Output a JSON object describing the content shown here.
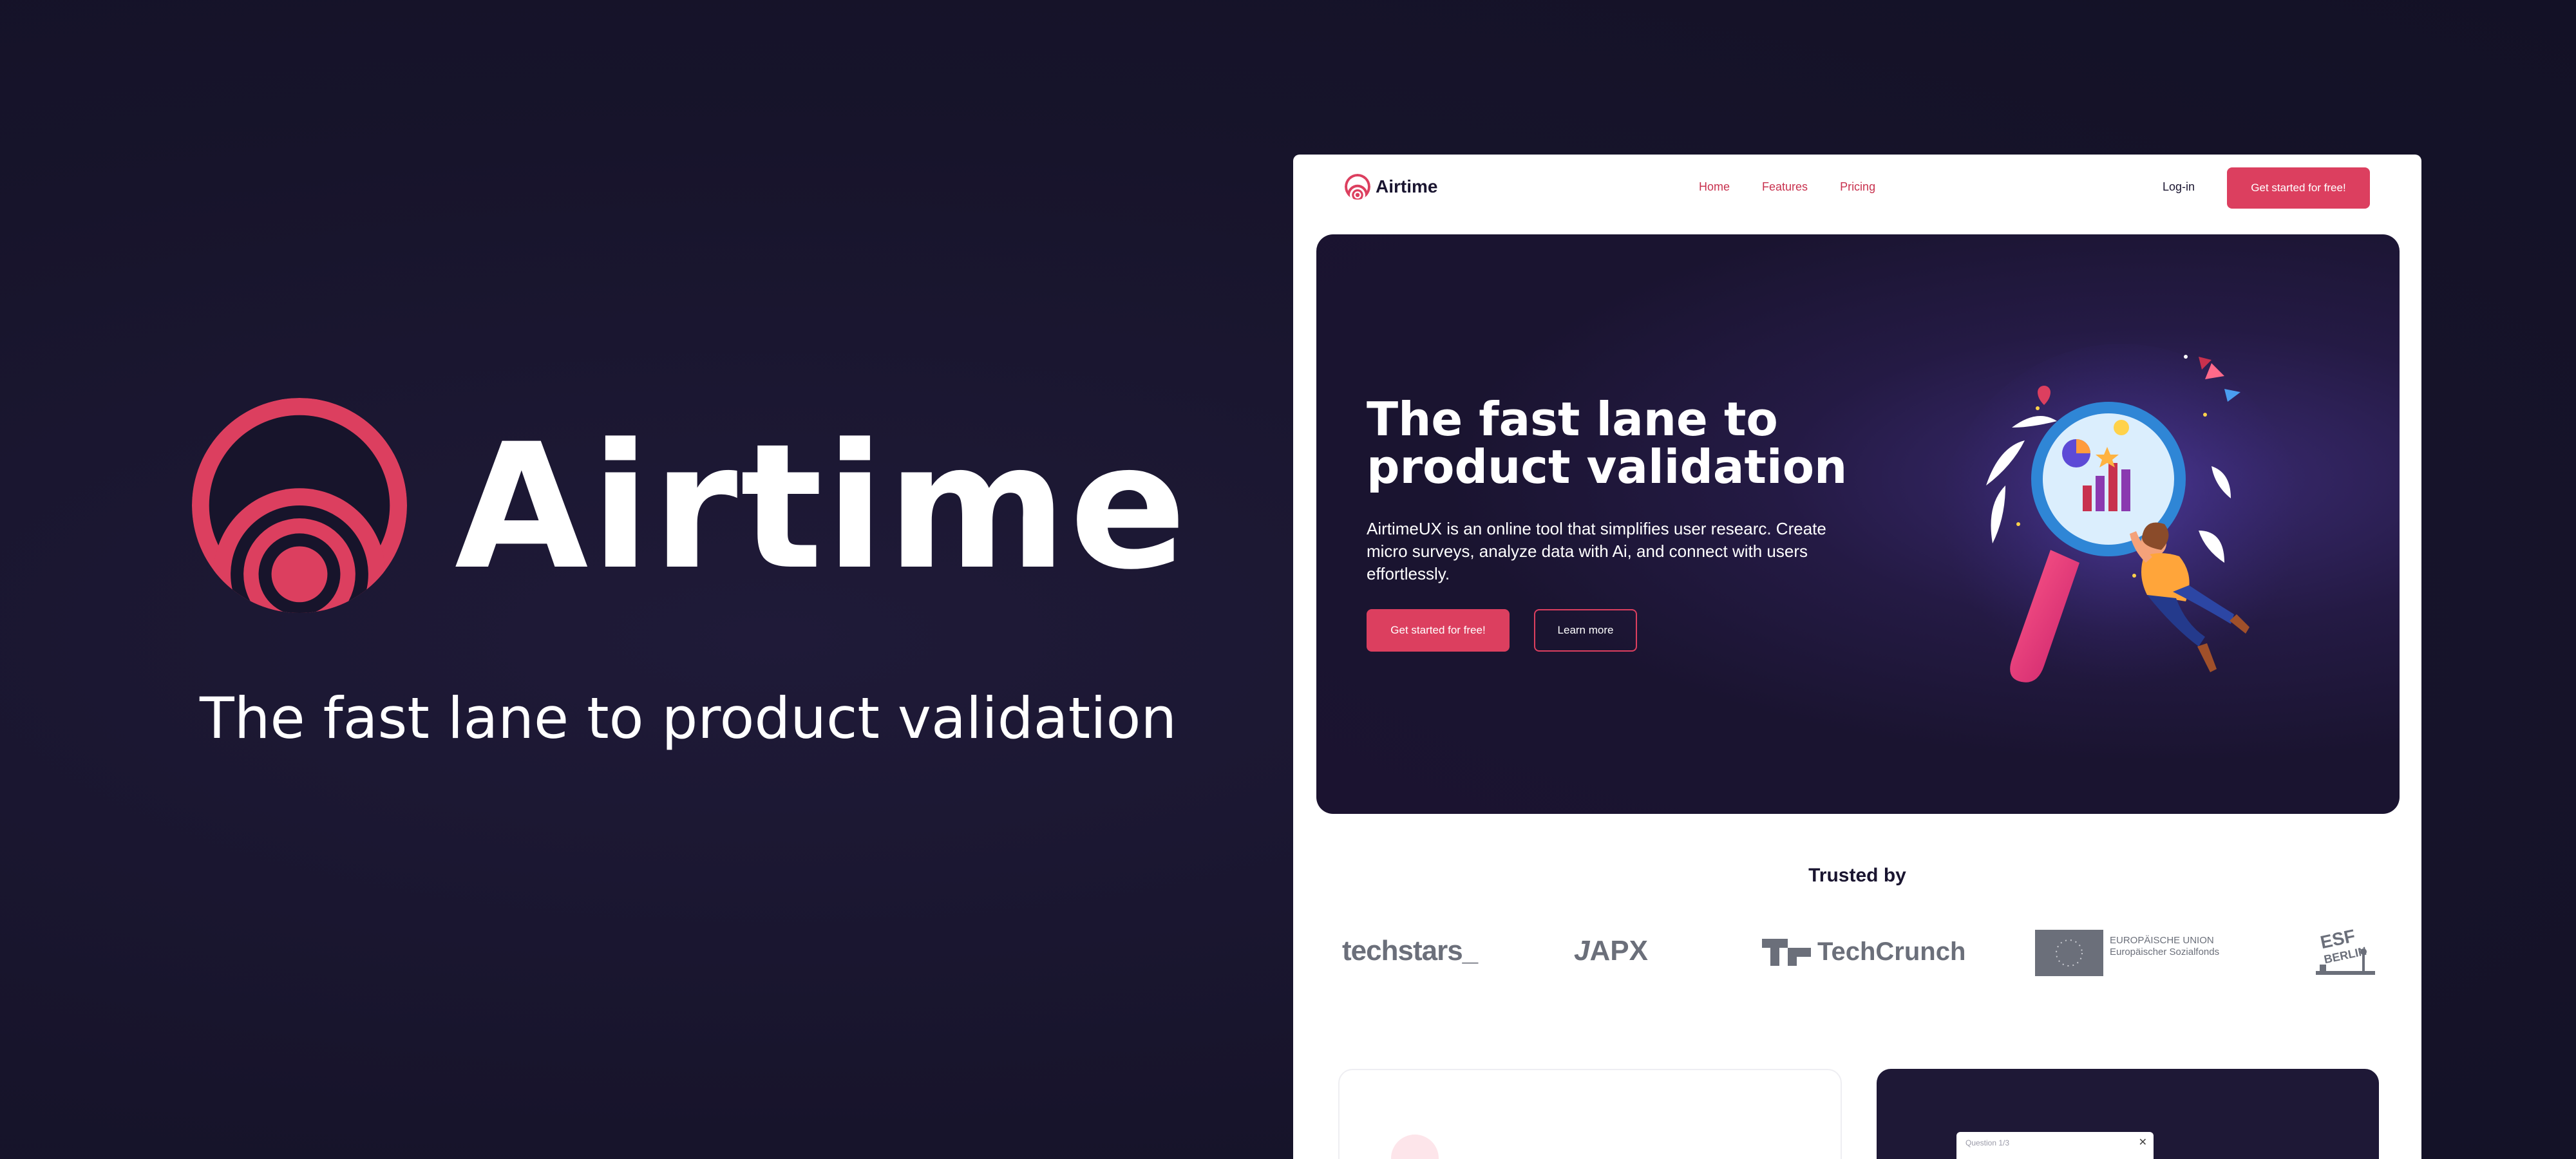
{
  "left_panel": {
    "brand_name": "Airtime",
    "tagline": "The fast lane to product validation"
  },
  "site": {
    "nav": {
      "brand": "Airtime",
      "links": [
        "Home",
        "Features",
        "Pricing"
      ],
      "login": "Log-in",
      "cta": "Get started for free!"
    },
    "hero": {
      "title": "The fast lane to product validation",
      "description": "AirtimeUX is an online tool that simplifies user researc. Create micro surveys, analyze data with Ai, and connect with users effortlessly.",
      "primary_button": "Get started for free!",
      "secondary_button": "Learn more"
    },
    "trusted": {
      "heading": "Trusted by",
      "logos": {
        "techstars": "techstars_",
        "apx": "APX",
        "techcrunch": "TechCrunch",
        "eu_line1": "EUROPÄISCHE UNION",
        "eu_line2": "Europäischer Sozialfonds",
        "esf": "ESF BERLIN"
      }
    },
    "preview_card": {
      "question_label": "Question 1/3",
      "close_glyph": "✕"
    }
  },
  "colors": {
    "accent": "#dc3f5f",
    "background": "#17142b",
    "nav_link": "#c8314e",
    "logo_gray": "#6b6f7a"
  },
  "icons": [
    "airtime-logo-icon",
    "close-icon",
    "eu-flag-icon",
    "esf-berlin-icon",
    "techcrunch-icon"
  ]
}
